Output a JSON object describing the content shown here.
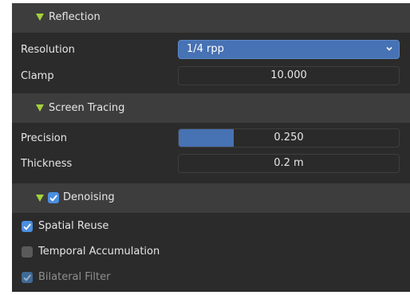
{
  "reflection": {
    "title": "Reflection",
    "resolution_label": "Resolution",
    "resolution_value": "1/4 rpp",
    "clamp_label": "Clamp",
    "clamp_value": "10.000"
  },
  "screen_tracing": {
    "title": "Screen Tracing",
    "precision_label": "Precision",
    "precision_value": "0.250",
    "precision_fraction": 0.25,
    "thickness_label": "Thickness",
    "thickness_value": "0.2 m"
  },
  "denoising": {
    "title": "Denoising",
    "enabled": true,
    "spatial_reuse_label": "Spatial Reuse",
    "spatial_reuse_checked": true,
    "temporal_label": "Temporal Accumulation",
    "temporal_checked": false,
    "bilateral_label": "Bilateral Filter",
    "bilateral_checked": true
  },
  "colors": {
    "accent": "#4772b3",
    "checkbox": "#4a8fe0",
    "triangle": "#a3d13b",
    "panel": "#303030"
  }
}
